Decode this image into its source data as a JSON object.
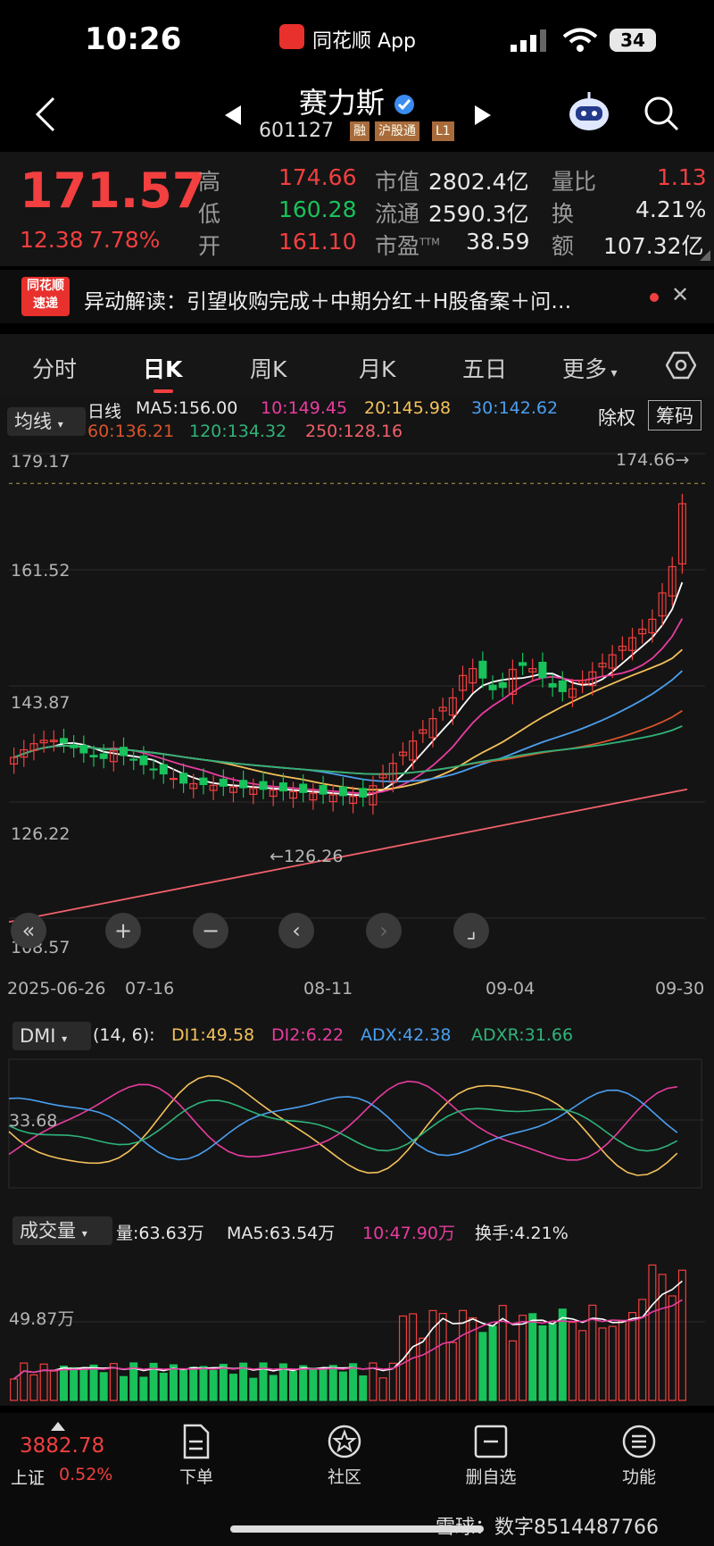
{
  "status_bar": {
    "time": "10:26",
    "app_name": "同花顺 App",
    "battery": "34"
  },
  "header": {
    "title": "赛力斯",
    "code": "601127",
    "tags": [
      "融",
      "沪股通",
      "L1"
    ]
  },
  "quote": {
    "price": "171.57",
    "change": "12.38",
    "change_pct": "7.78%",
    "high_label": "高",
    "high": "174.66",
    "low_label": "低",
    "low": "160.28",
    "open_label": "开",
    "open": "161.10",
    "mcap_label": "市值",
    "mcap": "2802.4亿",
    "float_label": "流通",
    "float": "2590.3亿",
    "pe_label": "市盈",
    "pe_sup": "TTM",
    "pe": "38.59",
    "vr_label": "量比",
    "vr": "1.13",
    "turnover_label": "换",
    "turnover": "4.21%",
    "amount_label": "额",
    "amount": "107.32亿"
  },
  "news": {
    "logo_top": "同花顺",
    "logo_bottom": "速递",
    "text": "异动解读：引望收购完成＋中期分红＋H股备案＋问…"
  },
  "tabs": [
    "分时",
    "日K",
    "周K",
    "月K",
    "五日",
    "更多"
  ],
  "ma_bar": {
    "selector": "均线",
    "period": "日线",
    "ma5": "MA5:156.00",
    "ma10": "10:149.45",
    "ma20": "20:145.98",
    "ma30": "30:142.62",
    "ma60": "60:136.21",
    "ma120": "120:134.32",
    "ma250": "250:128.16",
    "btn_adjust": "除权",
    "btn_chips": "筹码"
  },
  "k_axis": {
    "y_labels": [
      "179.17",
      "161.52",
      "143.87",
      "126.22",
      "108.57"
    ],
    "max_note": "174.66→",
    "min_note": "←126.26",
    "x_labels": [
      "2025-06-26",
      "07-16",
      "08-11",
      "09-04",
      "09-30"
    ]
  },
  "dmi": {
    "selector": "DMI",
    "params": "(14, 6):",
    "di1": "DI1:49.58",
    "di2": "DI2:6.22",
    "adx": "ADX:42.38",
    "adxr": "ADXR:31.66",
    "y_label": "33.68"
  },
  "volume": {
    "selector": "成交量",
    "vol": "量:63.63万",
    "ma5": "MA5:63.54万",
    "ma10": "10:47.90万",
    "turnover": "换手:4.21%",
    "y_label": "49.87万"
  },
  "bottom": {
    "index_value": "3882.78",
    "index_name": "上证",
    "index_pct": "0.52%",
    "nav": [
      "下单",
      "社区",
      "删自选",
      "功能"
    ],
    "watermark": "雪球：数字8514487766"
  },
  "colors": {
    "up": "#f23f3f",
    "down": "#19c25b",
    "ma5": "#ffffff",
    "ma10": "#e83ca0",
    "ma20": "#f4c15a",
    "ma30": "#4a9ff0",
    "ma60": "#d9542b",
    "ma120": "#2fb37a",
    "ma250": "#f0606a"
  }
}
